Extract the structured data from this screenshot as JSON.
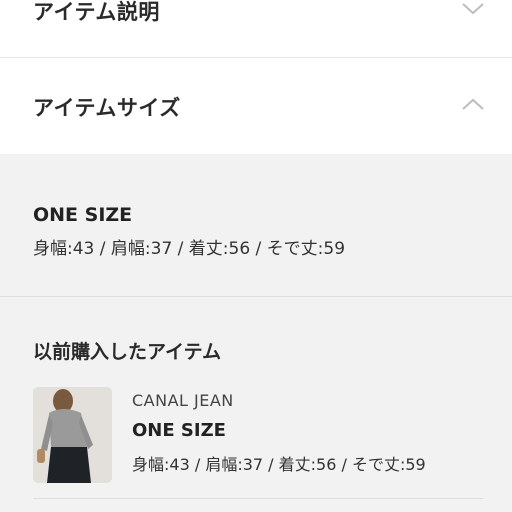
{
  "sections": {
    "description": {
      "title": "アイテム説明",
      "icon": "chevron-down-icon"
    },
    "size": {
      "title": "アイテムサイズ",
      "icon": "chevron-up-icon"
    }
  },
  "size_info": {
    "name": "ONE SIZE",
    "detail": "身幅:43 / 肩幅:37 / 着丈:56 / そで丈:59"
  },
  "previous_purchase": {
    "title": "以前購入したアイテム",
    "items": [
      {
        "brand": "CANAL JEAN",
        "size": "ONE SIZE",
        "detail": "身幅:43 / 肩幅:37 / 着丈:56 / そで丈:59"
      }
    ]
  }
}
